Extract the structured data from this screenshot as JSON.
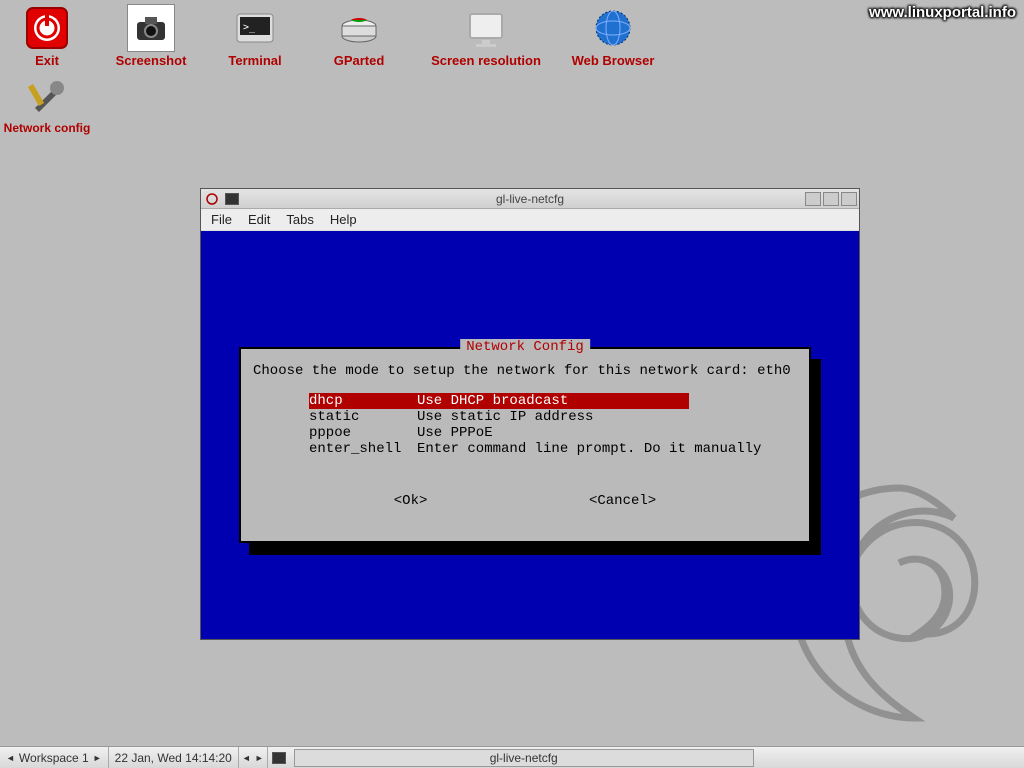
{
  "watermark": "www.linuxportal.info",
  "desktop": {
    "icons": [
      {
        "name": "exit",
        "label": "Exit"
      },
      {
        "name": "screenshot",
        "label": "Screenshot"
      },
      {
        "name": "terminal",
        "label": "Terminal"
      },
      {
        "name": "gparted",
        "label": "GParted"
      },
      {
        "name": "screen-res",
        "label": "Screen resolution"
      },
      {
        "name": "web-browser",
        "label": "Web Browser"
      },
      {
        "name": "network-config",
        "label": "Network config"
      }
    ]
  },
  "window": {
    "title": "gl-live-netcfg",
    "menu": {
      "file": "File",
      "edit": "Edit",
      "tabs": "Tabs",
      "help": "Help"
    }
  },
  "dialog": {
    "title": " Network Config ",
    "prompt": "Choose the mode to setup the network for this network card: eth0",
    "options": [
      {
        "key": "dhcp",
        "desc": "Use DHCP broadcast",
        "selected": true
      },
      {
        "key": "static",
        "desc": "Use static IP address",
        "selected": false
      },
      {
        "key": "pppoe",
        "desc": "Use PPPoE",
        "selected": false
      },
      {
        "key": "enter_shell",
        "desc": "Enter command line prompt. Do it manually",
        "selected": false
      }
    ],
    "ok": "<Ok>",
    "cancel": "<Cancel>"
  },
  "taskbar": {
    "workspace": "Workspace 1",
    "datetime": "22 Jan, Wed 14:14:20",
    "task": "gl-live-netcfg"
  }
}
